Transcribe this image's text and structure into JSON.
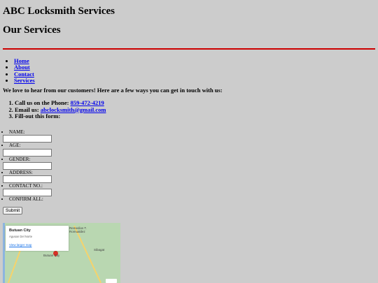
{
  "site": {
    "title": "ABC Locksmith Services",
    "subtitle": "Our Services"
  },
  "nav": {
    "items": [
      {
        "label": "Home"
      },
      {
        "label": "About"
      },
      {
        "label": "Contact"
      },
      {
        "label": "Services"
      }
    ]
  },
  "intro": "We love to hear from our customers! Here are a few ways you can get in touch with us:",
  "contact": {
    "phone_prefix": "Call us on the Phone: ",
    "phone": "859-472-4219",
    "email_prefix": "Email us: ",
    "email": "abclocksmith@gmail.com",
    "form_label": "Fill-out this form:"
  },
  "form": {
    "fields": [
      {
        "label": "NAME:"
      },
      {
        "label": "AGE:"
      },
      {
        "label": "GENDER:"
      },
      {
        "label": "ADDRESS:"
      },
      {
        "label": "CONTACT NO.:"
      },
      {
        "label": "CONFIRM ALL:"
      }
    ],
    "submit_label": "Submit"
  },
  "location": {
    "heading": "Butuan City",
    "map": {
      "card_title": "Butuan City",
      "card_subtitle": "Agusan Del Norte",
      "card_link": "View larger map",
      "labels": [
        "Remedios T. Romualdez",
        "Sibagat",
        "Butuan City"
      ]
    }
  },
  "colors": {
    "background": "#cccccc",
    "divider": "#cc0000",
    "link": "#0000ee"
  }
}
